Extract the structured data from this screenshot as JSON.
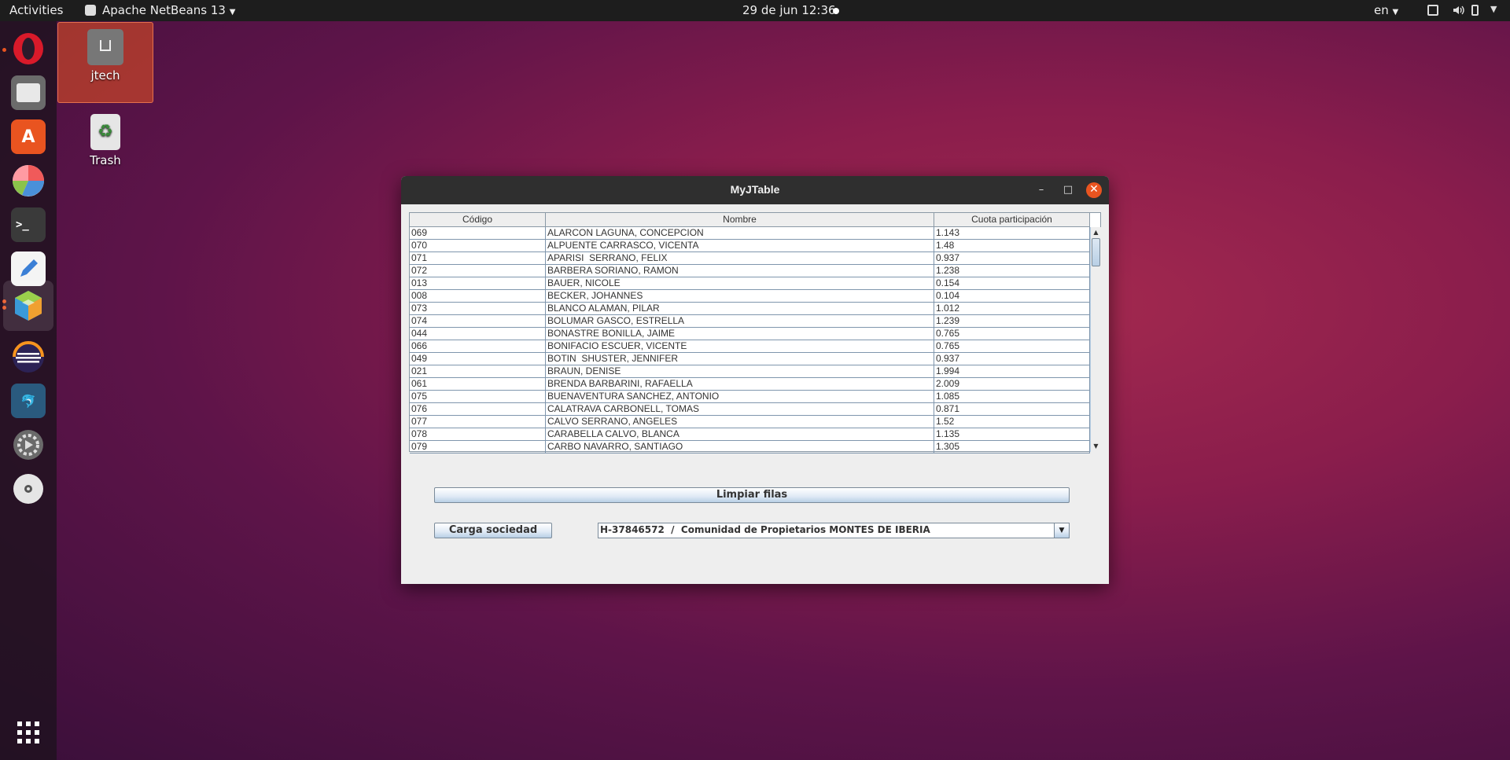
{
  "topbar": {
    "activities": "Activities",
    "app_name": "Apache NetBeans 13",
    "clock": "29 de jun  12:36",
    "lang": "en"
  },
  "dock": {
    "items": [
      "opera-icon",
      "files-icon",
      "software-icon",
      "chart-app-icon",
      "terminal-icon",
      "text-editor-icon",
      "netbeans-icon",
      "eclipse-icon",
      "mysql-workbench-icon",
      "settings-icon",
      "disc-icon",
      "show-apps-icon"
    ]
  },
  "desktop": {
    "home_label": "jtech",
    "trash_label": "Trash"
  },
  "window": {
    "title": "MyJTable",
    "table": {
      "headers": [
        "Código",
        "Nombre",
        "Cuota participación"
      ],
      "rows": [
        [
          "069",
          "ALARCON LAGUNA, CONCEPCION",
          "1.143"
        ],
        [
          "070",
          "ALPUENTE CARRASCO, VICENTA",
          "1.48"
        ],
        [
          "071",
          "APARISI  SERRANO, FELIX",
          "0.937"
        ],
        [
          "072",
          "BARBERA SORIANO, RAMON",
          "1.238"
        ],
        [
          "013",
          "BAUER, NICOLE",
          "0.154"
        ],
        [
          "008",
          "BECKER, JOHANNES",
          "0.104"
        ],
        [
          "073",
          "BLANCO ALAMAN, PILAR",
          "1.012"
        ],
        [
          "074",
          "BOLUMAR GASCO, ESTRELLA",
          "1.239"
        ],
        [
          "044",
          "BONASTRE BONILLA, JAIME",
          "0.765"
        ],
        [
          "066",
          "BONIFACIO ESCUER, VICENTE",
          "0.765"
        ],
        [
          "049",
          "BOTIN  SHUSTER, JENNIFER",
          "0.937"
        ],
        [
          "021",
          "BRAUN, DENISE",
          "1.994"
        ],
        [
          "061",
          "BRENDA BARBARINI, RAFAELLA",
          "2.009"
        ],
        [
          "075",
          "BUENAVENTURA SANCHEZ, ANTONIO",
          "1.085"
        ],
        [
          "076",
          "CALATRAVA CARBONELL, TOMAS",
          "0.871"
        ],
        [
          "077",
          "CALVO SERRANO, ANGELES",
          "1.52"
        ],
        [
          "078",
          "CARABELLA CALVO, BLANCA",
          "1.135"
        ],
        [
          "079",
          "CARBO NAVARRO, SANTIAGO",
          "1.305"
        ]
      ]
    },
    "limpiar_label": "Limpiar filas",
    "carga_label": "Carga sociedad",
    "combo_value": "H-37846572  /  Comunidad de Propietarios MONTES DE IBERIA"
  },
  "colors": {
    "accent": "#e95420",
    "selection_blue": "#b8cfe5"
  }
}
